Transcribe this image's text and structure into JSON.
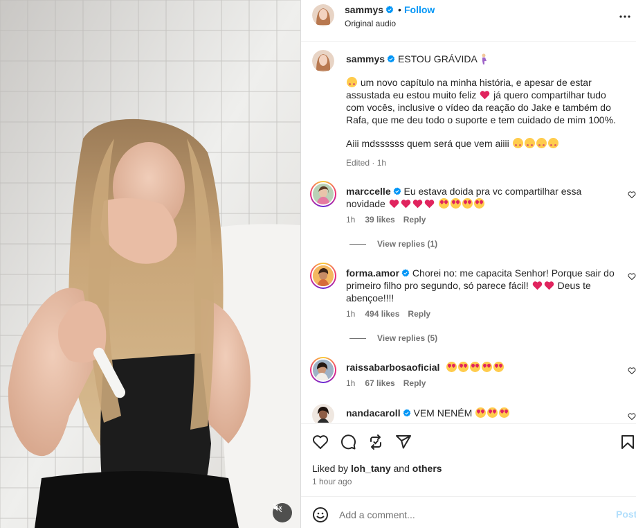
{
  "header": {
    "username": "sammys",
    "separator": "•",
    "follow_label": "Follow",
    "audio_label": "Original audio"
  },
  "caption": {
    "username": "sammys",
    "line1_text": "ESTOU GRÁVIDA",
    "body": "um novo capítulo na minha história, e apesar de estar assustada eu estou muito feliz",
    "body2": "já quero compartilhar tudo com vocês, inclusive o vídeo da reação do Jake e também do Rafa, que me deu todo o suporte e tem cuidado de mim 100%.",
    "line3": "Aiii mdssssss quem será que vem aiiii",
    "meta": "Edited · 1h"
  },
  "comments": [
    {
      "username": "marccelle",
      "text": "Eu estava doida pra vc compartilhar essa novidade",
      "time": "1h",
      "likes": "39 likes",
      "reply_label": "Reply",
      "view_replies": "View replies (1)"
    },
    {
      "username": "forma.amor",
      "text": "Chorei no: me capacita Senhor! Porque sair do primeiro filho pro segundo, só parece fácil!",
      "text2": "Deus te abençoe!!!!",
      "time": "1h",
      "likes": "494 likes",
      "reply_label": "Reply",
      "view_replies": "View replies (5)"
    },
    {
      "username": "raissabarbosaoficial",
      "text": "",
      "time": "1h",
      "likes": "67 likes",
      "reply_label": "Reply"
    },
    {
      "username": "nandacaroll",
      "text": "VEM NENÉM"
    }
  ],
  "actions": {
    "liked_by_prefix": "Liked by",
    "liked_by_user": "loh_tany",
    "liked_by_and": "and",
    "liked_by_others": "others",
    "time": "1 hour ago"
  },
  "comment_box": {
    "placeholder": "Add a comment...",
    "post_label": "Post"
  },
  "colors": {
    "link_blue": "#0095f6",
    "verified_blue": "#0095f6",
    "post_disabled": "#b2dffc",
    "muted_text": "#737373",
    "heart_red": "#ed4956"
  },
  "icons": {
    "more": "more-horizontal-icon",
    "like": "heart-icon",
    "comment": "comment-icon",
    "share": "repost-icon",
    "send": "send-icon",
    "save": "bookmark-icon",
    "emoji": "emoji-icon",
    "mute": "speaker-muted-icon"
  }
}
